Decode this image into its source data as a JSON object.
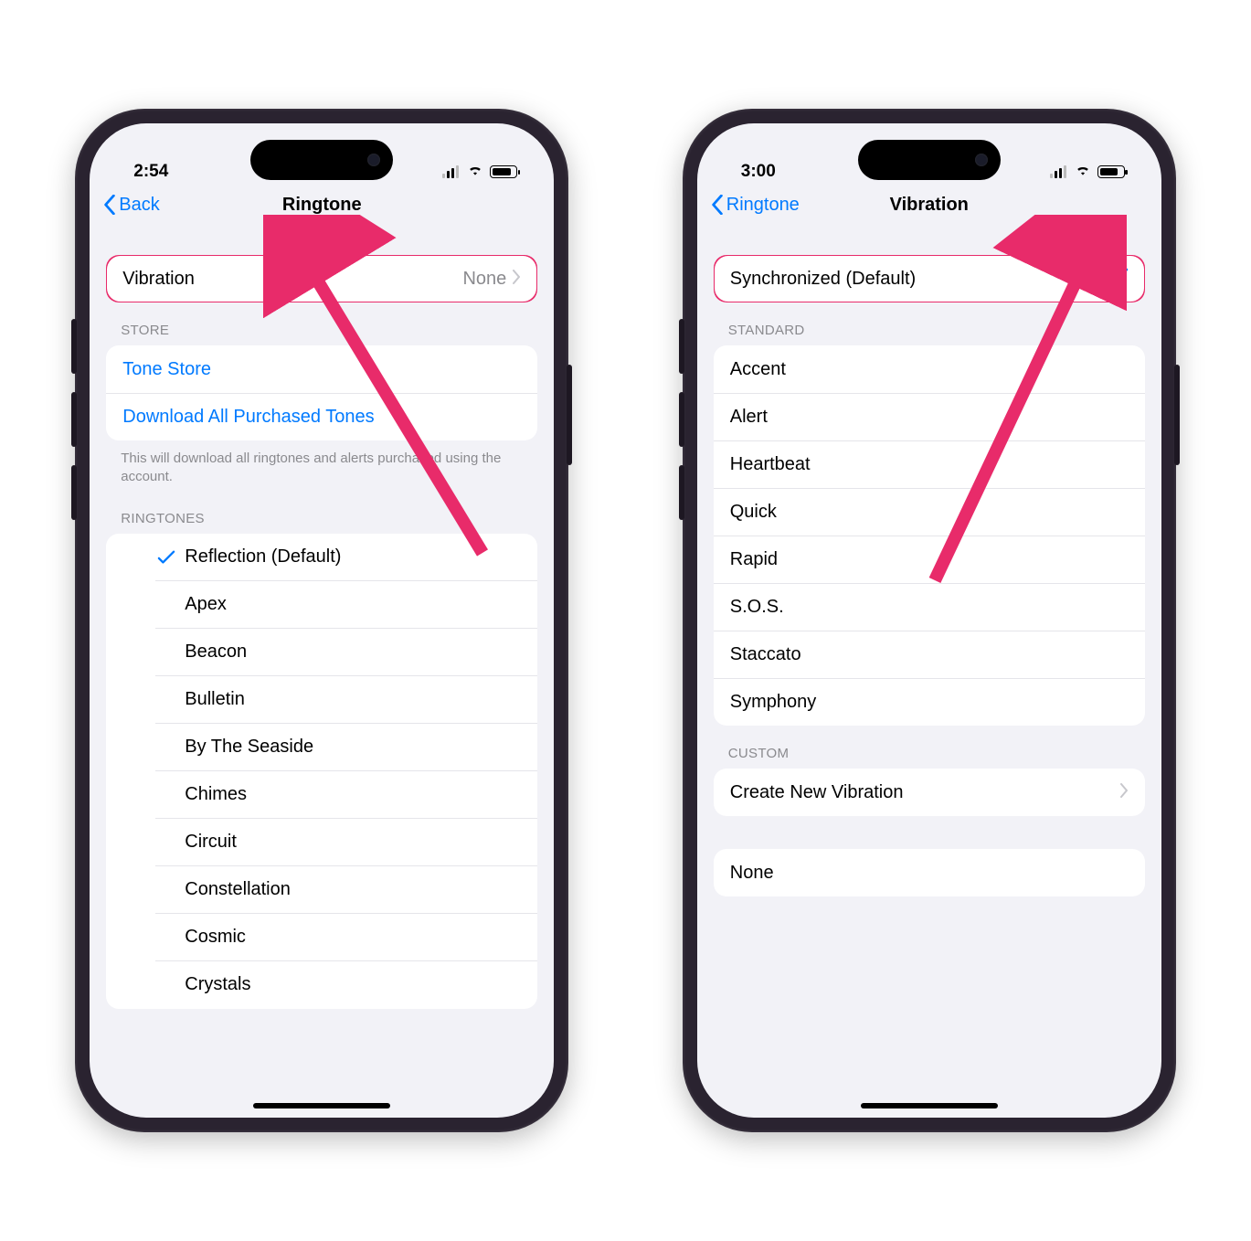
{
  "left": {
    "status_time": "2:54",
    "nav_back": "Back",
    "nav_title": "Ringtone",
    "vibration_row": {
      "label": "Vibration",
      "value": "None"
    },
    "store_header": "STORE",
    "store_rows": [
      {
        "label": "Tone Store"
      },
      {
        "label": "Download All Purchased Tones"
      }
    ],
    "store_footer": "This will download all ringtones and alerts purchased using the                                    account.",
    "ringtones_header": "RINGTONES",
    "ringtones": [
      {
        "label": "Reflection (Default)",
        "selected": true
      },
      {
        "label": "Apex"
      },
      {
        "label": "Beacon"
      },
      {
        "label": "Bulletin"
      },
      {
        "label": "By The Seaside"
      },
      {
        "label": "Chimes"
      },
      {
        "label": "Circuit"
      },
      {
        "label": "Constellation"
      },
      {
        "label": "Cosmic"
      },
      {
        "label": "Crystals"
      }
    ]
  },
  "right": {
    "status_time": "3:00",
    "nav_back": "Ringtone",
    "nav_title": "Vibration",
    "default_row": {
      "label": "Synchronized (Default)",
      "selected": true
    },
    "standard_header": "STANDARD",
    "standard": [
      {
        "label": "Accent"
      },
      {
        "label": "Alert"
      },
      {
        "label": "Heartbeat"
      },
      {
        "label": "Quick"
      },
      {
        "label": "Rapid"
      },
      {
        "label": "S.O.S."
      },
      {
        "label": "Staccato"
      },
      {
        "label": "Symphony"
      }
    ],
    "custom_header": "CUSTOM",
    "custom_row": {
      "label": "Create New Vibration"
    },
    "none_row": {
      "label": "None"
    }
  },
  "annotation_color": "#e82b6a"
}
